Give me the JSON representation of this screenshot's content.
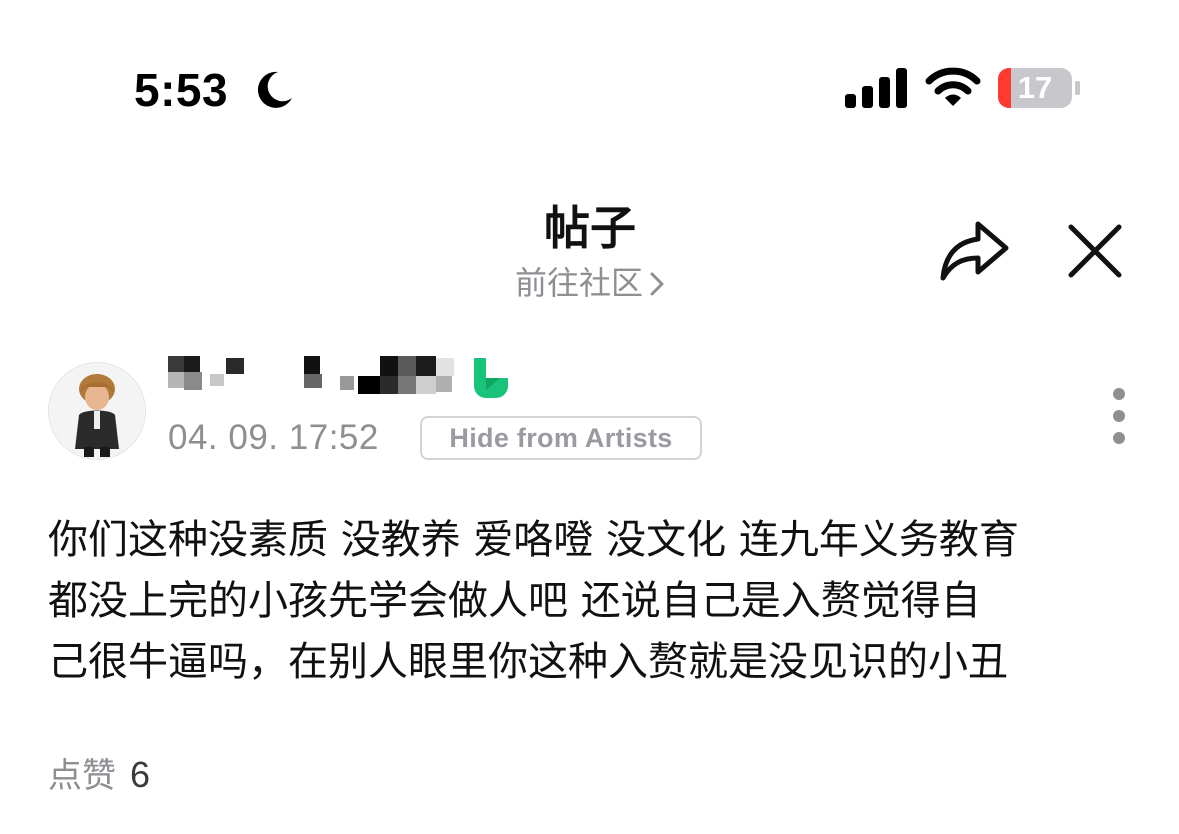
{
  "status_bar": {
    "time": "5:53",
    "battery_level": "17",
    "battery_fraction": 0.17,
    "icons": [
      "moon-icon",
      "signal-icon",
      "wifi-icon",
      "battery-icon"
    ],
    "battery_low_color": "#ff3b30"
  },
  "header": {
    "title": "帖子",
    "community_link": "前往社区",
    "icons": [
      "chevron-right-icon",
      "share-icon",
      "close-icon"
    ]
  },
  "post": {
    "username": "",
    "date": "04. 09. 17:52",
    "badge": "Hide from Artists",
    "content": "你们这种没素质 没教养 爱咯噔 没文化 连九年义务教育\n都没上完的小孩先学会做人吧 还说自己是入赘觉得自\n己很牛逼吗，在别人眼里你这种入赘就是没见识的小丑",
    "verified_color": "#19c37a",
    "icons": [
      "avatar",
      "verified-badge-icon",
      "more-vertical-icon"
    ]
  },
  "likes": {
    "label": "点赞",
    "count": "6"
  }
}
